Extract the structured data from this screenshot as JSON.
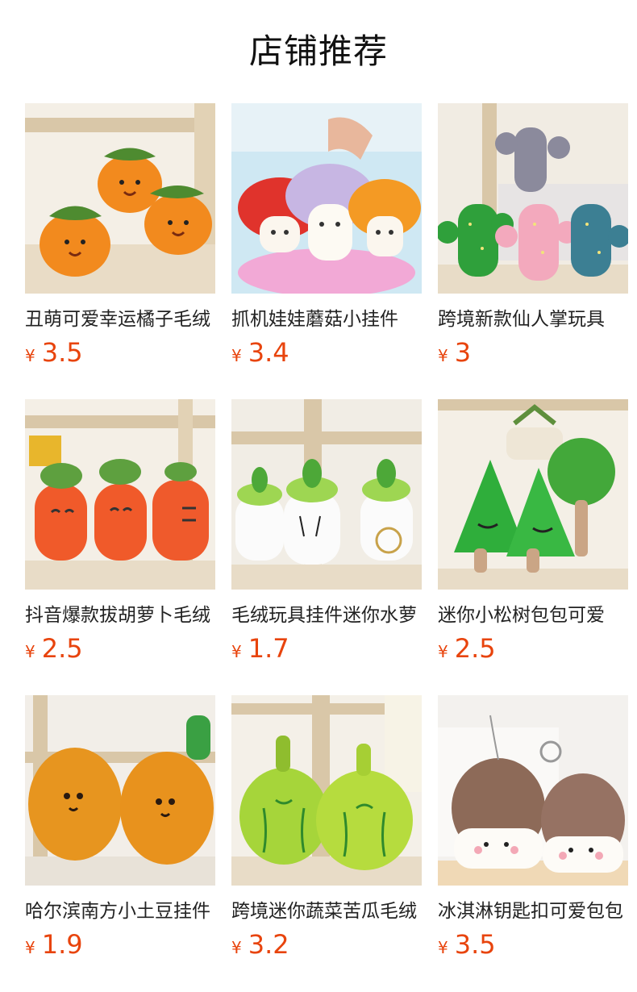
{
  "header": {
    "title": "店铺推荐"
  },
  "currency_symbol": "¥",
  "colors": {
    "price": "#e8440d",
    "title": "#111111",
    "text": "#222222"
  },
  "products": [
    {
      "name": "丑萌可爱幸运橘子毛绒",
      "price": "3.5",
      "image_icon": "orange-plush-image"
    },
    {
      "name": "抓机娃娃蘑菇小挂件",
      "price": "3.4",
      "image_icon": "mushroom-plush-image"
    },
    {
      "name": "跨境新款仙人掌玩具",
      "price": "3",
      "image_icon": "cactus-plush-image"
    },
    {
      "name": "抖音爆款拔胡萝卜毛绒",
      "price": "2.5",
      "image_icon": "carrot-plush-image"
    },
    {
      "name": "毛绒玩具挂件迷你水萝卜",
      "price": "1.7",
      "image_icon": "radish-plush-image"
    },
    {
      "name": "迷你小松树包包可爱",
      "price": "2.5",
      "image_icon": "pine-tree-plush-image"
    },
    {
      "name": "哈尔滨南方小土豆挂件",
      "price": "1.9",
      "image_icon": "potato-plush-image"
    },
    {
      "name": "跨境迷你蔬菜苦瓜毛绒",
      "price": "3.2",
      "image_icon": "bitter-melon-plush-image"
    },
    {
      "name": "冰淇淋钥匙扣可爱包包",
      "price": "3.5",
      "image_icon": "ice-cream-plush-image"
    }
  ]
}
